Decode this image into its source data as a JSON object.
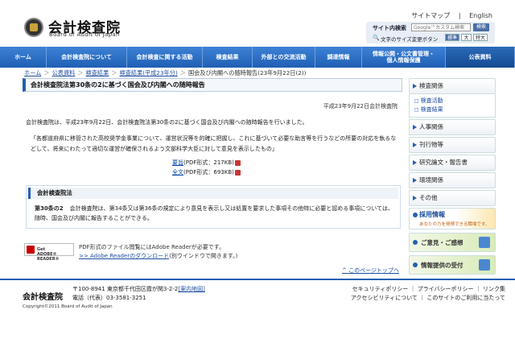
{
  "header": {
    "logo_ja": "会計検査院",
    "logo_en": "Board of Audit of Japan",
    "top_links": [
      "サイトマップ",
      "English"
    ],
    "search": {
      "label": "サイト内検索",
      "placeholder": "Google™カスタム検索",
      "button": "検索"
    },
    "font_size": {
      "label": "文字のサイズ変更ボタン",
      "buttons": [
        "標準",
        "大",
        "特大"
      ],
      "active": "標準"
    }
  },
  "nav": {
    "items": [
      "ホーム",
      "会計検査院について",
      "会計検査に関する活動",
      "検査結果",
      "外部との交流活動",
      "調達情報",
      "情報公開・公文書管理・個人情報保護",
      "公表資料"
    ],
    "active": "公表資料"
  },
  "breadcrumb": {
    "items": [
      "ホーム",
      "公表資料",
      "検査結果",
      "検査結果(平成23年分)"
    ],
    "current": "国会及び内閣への随時報告(23年9月22日(2))"
  },
  "main": {
    "title": "会計検査院法第30条の2に基づく国会及び内閣への随時報告",
    "date": "平成23年9月22日会計検査院",
    "intro": "会計検査院は、平成23年9月22日、会計検査院法第30条の2に基づく国会及び内閣への随時報告を行いました。",
    "quote": "「各都道府県に移管された高校奨学金事業について、運営状況等を的確に把握し、これに基づいて必要な助言等を行うなどの所要の対応を執るなどして、将来にわたって適切な運営が確保されるよう文部科学大臣に対して意見を表示したもの」",
    "links": [
      {
        "label": "要旨",
        "info": "(PDF形式：217KB)"
      },
      {
        "label": "全文",
        "info": "(PDF形式：693KB)"
      }
    ],
    "law": {
      "title": "会計検査院法",
      "article": "第30条の2",
      "text": "会計検査院は、第34条又は第36条の規定により意見を表示し又は処置を要求した事項その他特に必要と認める事項については、随時、国会及び内閣に報告することができる。"
    },
    "adobe": {
      "badge_small": "Get",
      "badge": "ADOBE® READER®",
      "note": "PDF形式のファイル閲覧にはAdobe Readerが必要です。",
      "link": ">> Adobe Readerのダウンロード",
      "link_suffix": "(別ウインドウで開きます。)"
    },
    "to_top": "このページトップへ"
  },
  "sidebar": {
    "sections": [
      {
        "label": "検査関係",
        "subs": [
          "検査活動",
          "検査結果"
        ]
      },
      {
        "label": "人事関係",
        "subs": []
      },
      {
        "label": "刊行物等",
        "subs": []
      },
      {
        "label": "研究論文・報告書",
        "subs": []
      },
      {
        "label": "環境関係",
        "subs": []
      },
      {
        "label": "その他",
        "subs": []
      }
    ],
    "recruit_title": "採用情報",
    "recruit_sub": "あなたの力を発揮できる職場です。",
    "banners": [
      "ご意見・ご感想",
      "情報提供の受付"
    ]
  },
  "footer": {
    "name": "会計検査院",
    "address": "〒100-8941 東京都千代田区霞が関3-2-2",
    "map_link": "[案内地図]",
    "phone": "電話（代表）03-3581-3251",
    "copyright": "Copyright©2011 Board of Audit of Japan",
    "links_row1": "セキュリティポリシー ｜ プライバシーポリシー ｜ リンク集",
    "links_row2": "アクセシビリティについて ｜ このサイトのご利用に当たって"
  }
}
